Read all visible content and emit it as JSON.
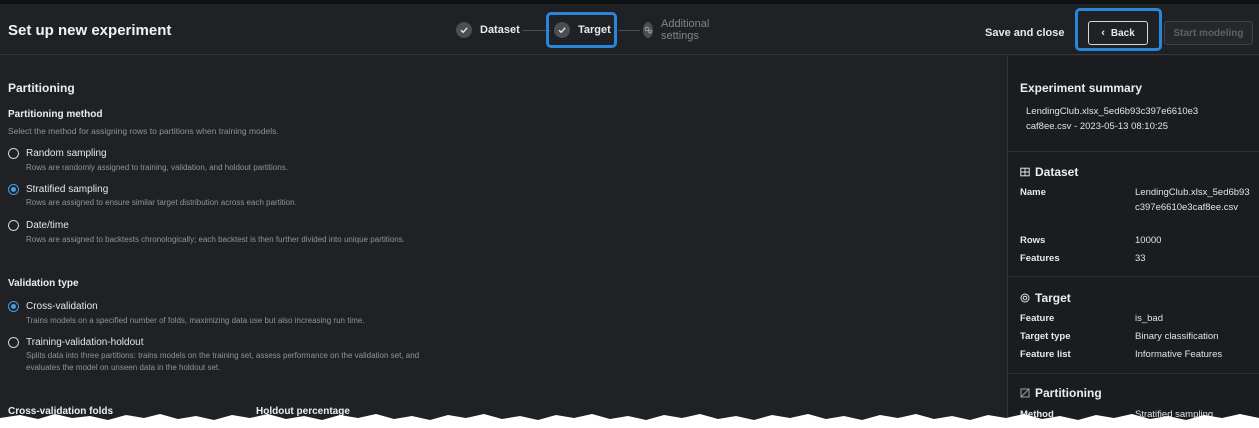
{
  "header": {
    "title": "Set up new experiment",
    "steps": [
      {
        "label": "Dataset",
        "state": "complete"
      },
      {
        "label": "Target",
        "state": "complete"
      },
      {
        "label": "Additional settings",
        "state": "pending"
      }
    ],
    "save_close": "Save and close",
    "back": "Back",
    "start": "Start modeling"
  },
  "partitioning": {
    "title": "Partitioning",
    "method_title": "Partitioning method",
    "method_desc": "Select the method for assigning rows to partitions when training models.",
    "options": [
      {
        "label": "Random sampling",
        "desc": "Rows are randomly assigned to training, validation, and holdout partitions.",
        "selected": false
      },
      {
        "label": "Stratified sampling",
        "desc": "Rows are assigned to ensure similar target distribution across each partition.",
        "selected": true
      },
      {
        "label": "Date/time",
        "desc": "Rows are assigned to backtests chronologically; each backtest is then further divided into unique partitions.",
        "selected": false
      }
    ],
    "validation_title": "Validation type",
    "validation_options": [
      {
        "label": "Cross-validation",
        "desc": "Trains models on a specified number of folds, maximizing data use but also increasing run time.",
        "selected": true
      },
      {
        "label": "Training-validation-holdout",
        "desc1": "Splits data into three partitions: trains models on the training set, assess performance on the validation set, and",
        "desc2": "evaluates the model on unseen data in the holdout set.",
        "selected": false
      }
    ],
    "cv_folds_label": "Cross-validation folds",
    "holdout_label": "Holdout percentage"
  },
  "summary": {
    "title": "Experiment summary",
    "file_line1": "LendingClub.xlsx_5ed6b93c397e6610e3",
    "file_line2": "caf8ee.csv - 2023-05-13 08:10:25",
    "dataset": {
      "title": "Dataset",
      "name_key": "Name",
      "name_val": "LendingClub.xlsx_5ed6b93c397e6610e3caf8ee.csv",
      "rows_key": "Rows",
      "rows_val": "10000",
      "features_key": "Features",
      "features_val": "33"
    },
    "target": {
      "title": "Target",
      "feature_key": "Feature",
      "feature_val": "is_bad",
      "type_key": "Target type",
      "type_val": "Binary classification",
      "list_key": "Feature list",
      "list_val": "Informative Features"
    },
    "partitioning": {
      "title": "Partitioning",
      "method_key": "Method",
      "method_val": "Stratified sampling"
    }
  },
  "colors": {
    "highlight": "#2a86d8",
    "radio_selected": "#4a9ae3",
    "background": "#1f2125"
  }
}
